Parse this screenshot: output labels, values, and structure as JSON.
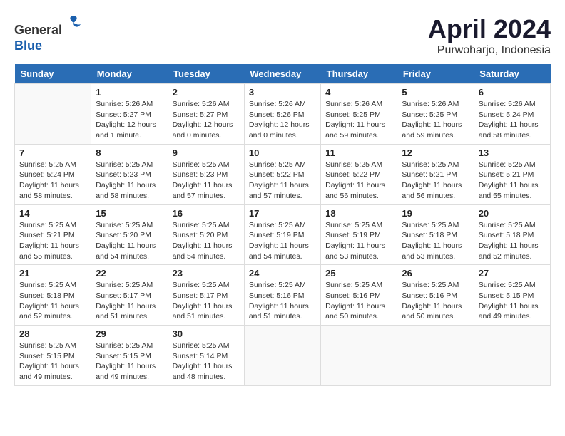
{
  "header": {
    "logo": {
      "general": "General",
      "blue": "Blue"
    },
    "title": "April 2024",
    "subtitle": "Purwoharjo, Indonesia"
  },
  "days_of_week": [
    "Sunday",
    "Monday",
    "Tuesday",
    "Wednesday",
    "Thursday",
    "Friday",
    "Saturday"
  ],
  "weeks": [
    [
      {
        "day": "",
        "info": ""
      },
      {
        "day": "1",
        "info": "Sunrise: 5:26 AM\nSunset: 5:27 PM\nDaylight: 12 hours\nand 1 minute."
      },
      {
        "day": "2",
        "info": "Sunrise: 5:26 AM\nSunset: 5:27 PM\nDaylight: 12 hours\nand 0 minutes."
      },
      {
        "day": "3",
        "info": "Sunrise: 5:26 AM\nSunset: 5:26 PM\nDaylight: 12 hours\nand 0 minutes."
      },
      {
        "day": "4",
        "info": "Sunrise: 5:26 AM\nSunset: 5:25 PM\nDaylight: 11 hours\nand 59 minutes."
      },
      {
        "day": "5",
        "info": "Sunrise: 5:26 AM\nSunset: 5:25 PM\nDaylight: 11 hours\nand 59 minutes."
      },
      {
        "day": "6",
        "info": "Sunrise: 5:26 AM\nSunset: 5:24 PM\nDaylight: 11 hours\nand 58 minutes."
      }
    ],
    [
      {
        "day": "7",
        "info": "Sunrise: 5:25 AM\nSunset: 5:24 PM\nDaylight: 11 hours\nand 58 minutes."
      },
      {
        "day": "8",
        "info": "Sunrise: 5:25 AM\nSunset: 5:23 PM\nDaylight: 11 hours\nand 58 minutes."
      },
      {
        "day": "9",
        "info": "Sunrise: 5:25 AM\nSunset: 5:23 PM\nDaylight: 11 hours\nand 57 minutes."
      },
      {
        "day": "10",
        "info": "Sunrise: 5:25 AM\nSunset: 5:22 PM\nDaylight: 11 hours\nand 57 minutes."
      },
      {
        "day": "11",
        "info": "Sunrise: 5:25 AM\nSunset: 5:22 PM\nDaylight: 11 hours\nand 56 minutes."
      },
      {
        "day": "12",
        "info": "Sunrise: 5:25 AM\nSunset: 5:21 PM\nDaylight: 11 hours\nand 56 minutes."
      },
      {
        "day": "13",
        "info": "Sunrise: 5:25 AM\nSunset: 5:21 PM\nDaylight: 11 hours\nand 55 minutes."
      }
    ],
    [
      {
        "day": "14",
        "info": "Sunrise: 5:25 AM\nSunset: 5:21 PM\nDaylight: 11 hours\nand 55 minutes."
      },
      {
        "day": "15",
        "info": "Sunrise: 5:25 AM\nSunset: 5:20 PM\nDaylight: 11 hours\nand 54 minutes."
      },
      {
        "day": "16",
        "info": "Sunrise: 5:25 AM\nSunset: 5:20 PM\nDaylight: 11 hours\nand 54 minutes."
      },
      {
        "day": "17",
        "info": "Sunrise: 5:25 AM\nSunset: 5:19 PM\nDaylight: 11 hours\nand 54 minutes."
      },
      {
        "day": "18",
        "info": "Sunrise: 5:25 AM\nSunset: 5:19 PM\nDaylight: 11 hours\nand 53 minutes."
      },
      {
        "day": "19",
        "info": "Sunrise: 5:25 AM\nSunset: 5:18 PM\nDaylight: 11 hours\nand 53 minutes."
      },
      {
        "day": "20",
        "info": "Sunrise: 5:25 AM\nSunset: 5:18 PM\nDaylight: 11 hours\nand 52 minutes."
      }
    ],
    [
      {
        "day": "21",
        "info": "Sunrise: 5:25 AM\nSunset: 5:18 PM\nDaylight: 11 hours\nand 52 minutes."
      },
      {
        "day": "22",
        "info": "Sunrise: 5:25 AM\nSunset: 5:17 PM\nDaylight: 11 hours\nand 51 minutes."
      },
      {
        "day": "23",
        "info": "Sunrise: 5:25 AM\nSunset: 5:17 PM\nDaylight: 11 hours\nand 51 minutes."
      },
      {
        "day": "24",
        "info": "Sunrise: 5:25 AM\nSunset: 5:16 PM\nDaylight: 11 hours\nand 51 minutes."
      },
      {
        "day": "25",
        "info": "Sunrise: 5:25 AM\nSunset: 5:16 PM\nDaylight: 11 hours\nand 50 minutes."
      },
      {
        "day": "26",
        "info": "Sunrise: 5:25 AM\nSunset: 5:16 PM\nDaylight: 11 hours\nand 50 minutes."
      },
      {
        "day": "27",
        "info": "Sunrise: 5:25 AM\nSunset: 5:15 PM\nDaylight: 11 hours\nand 49 minutes."
      }
    ],
    [
      {
        "day": "28",
        "info": "Sunrise: 5:25 AM\nSunset: 5:15 PM\nDaylight: 11 hours\nand 49 minutes."
      },
      {
        "day": "29",
        "info": "Sunrise: 5:25 AM\nSunset: 5:15 PM\nDaylight: 11 hours\nand 49 minutes."
      },
      {
        "day": "30",
        "info": "Sunrise: 5:25 AM\nSunset: 5:14 PM\nDaylight: 11 hours\nand 48 minutes."
      },
      {
        "day": "",
        "info": ""
      },
      {
        "day": "",
        "info": ""
      },
      {
        "day": "",
        "info": ""
      },
      {
        "day": "",
        "info": ""
      }
    ]
  ]
}
